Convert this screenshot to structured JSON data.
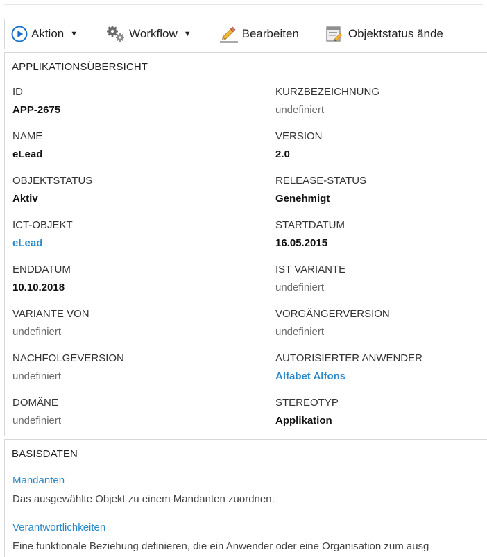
{
  "toolbar": {
    "aktion_label": "Aktion",
    "workflow_label": "Workflow",
    "edit_label": "Bearbeiten",
    "status_label": "Objektstatus ände"
  },
  "overview": {
    "title": "APPLIKATIONSÜBERSICHT",
    "fields": [
      {
        "label": "ID",
        "value": "APP-2675",
        "style": "bold"
      },
      {
        "label": "KURZBEZEICHNUNG",
        "value": "undefiniert",
        "style": "undef"
      },
      {
        "label": "NAME",
        "value": "eLead",
        "style": "bold"
      },
      {
        "label": "VERSION",
        "value": "2.0",
        "style": "bold"
      },
      {
        "label": "OBJEKTSTATUS",
        "value": "Aktiv",
        "style": "bold"
      },
      {
        "label": "RELEASE-STATUS",
        "value": "Genehmigt",
        "style": "bold"
      },
      {
        "label": "ICT-OBJEKT",
        "value": "eLead",
        "style": "link"
      },
      {
        "label": "STARTDATUM",
        "value": "16.05.2015",
        "style": "bold"
      },
      {
        "label": "ENDDATUM",
        "value": "10.10.2018",
        "style": "bold"
      },
      {
        "label": "IST VARIANTE",
        "value": "undefiniert",
        "style": "undef"
      },
      {
        "label": "VARIANTE VON",
        "value": "undefiniert",
        "style": "undef"
      },
      {
        "label": "VORGÄNGERVERSION",
        "value": "undefiniert",
        "style": "undef"
      },
      {
        "label": "NACHFOLGEVERSION",
        "value": "undefiniert",
        "style": "undef"
      },
      {
        "label": "AUTORISIERTER ANWENDER",
        "value": "Alfabet Alfons",
        "style": "link"
      },
      {
        "label": "DOMÄNE",
        "value": "undefiniert",
        "style": "undef"
      },
      {
        "label": "STEREOTYP",
        "value": "Applikation",
        "style": "bold"
      }
    ]
  },
  "basis": {
    "title": "BASISDATEN",
    "items": [
      {
        "link": "Mandanten",
        "description": "Das ausgewählte Objekt zu einem Mandanten zuordnen."
      },
      {
        "link": "Verantwortlichkeiten",
        "description": "Eine funktionale Beziehung definieren, die ein Anwender oder eine Organisation zum ausg"
      }
    ]
  },
  "colors": {
    "link": "#2a8ac8",
    "aktion_icon": "#1a73c9"
  },
  "icons": {
    "aktion": "play-circle-icon",
    "workflow": "gears-icon",
    "edit": "pencil-icon",
    "status": "document-edit-icon"
  }
}
